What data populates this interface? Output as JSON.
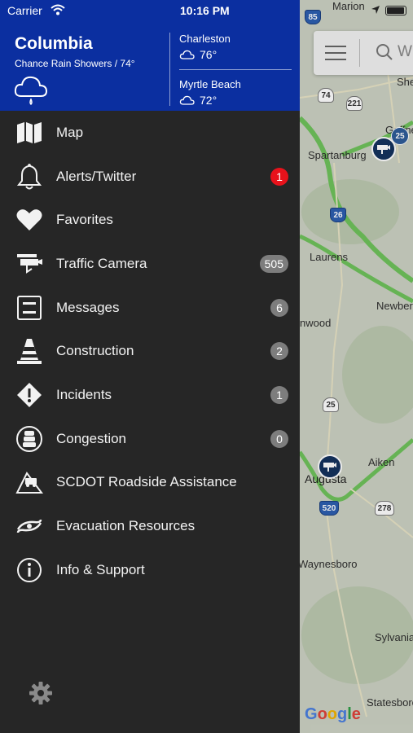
{
  "status": {
    "carrier": "Carrier",
    "time": "10:16 PM"
  },
  "weather": {
    "city": "Columbia",
    "condition": "Chance Rain Showers / 74°",
    "others": [
      {
        "city": "Charleston",
        "temp": "76°"
      },
      {
        "city": "Myrtle Beach",
        "temp": "72°"
      }
    ]
  },
  "menu": [
    {
      "label": "Map",
      "icon": "map-icon",
      "badge": ""
    },
    {
      "label": "Alerts/Twitter",
      "icon": "bell-icon",
      "badge": "1"
    },
    {
      "label": "Favorites",
      "icon": "heart-icon",
      "badge": ""
    },
    {
      "label": "Traffic Camera",
      "icon": "camera-icon",
      "badge": "505"
    },
    {
      "label": "Messages",
      "icon": "message-sign-icon",
      "badge": "6"
    },
    {
      "label": "Construction",
      "icon": "cone-icon",
      "badge": "2"
    },
    {
      "label": "Incidents",
      "icon": "warning-diamond-icon",
      "badge": "1"
    },
    {
      "label": "Congestion",
      "icon": "traffic-jam-icon",
      "badge": "0"
    },
    {
      "label": "SCDOT Roadside Assistance",
      "icon": "roadside-truck-icon",
      "badge": ""
    },
    {
      "label": "Evacuation Resources",
      "icon": "hurricane-icon",
      "badge": ""
    },
    {
      "label": "Info & Support",
      "icon": "info-icon",
      "badge": ""
    }
  ],
  "map": {
    "search_placeholder": "W",
    "labels": [
      "Marion",
      "Gaffney",
      "Spartanburg",
      "Laurens",
      "Newber",
      "nwood",
      "Augusta",
      "Aiken",
      "Waynesboro",
      "Sylvania",
      "Statesboro",
      "She"
    ],
    "shields": [
      "74",
      "221",
      "26",
      "25",
      "520",
      "278",
      "85"
    ],
    "pin_badge": "25",
    "attribution": "Google"
  },
  "colors": {
    "header": "#0b2fa0",
    "drawer": "#262626",
    "alert_badge": "#e8121b",
    "count_badge": "#7d7d7d"
  }
}
